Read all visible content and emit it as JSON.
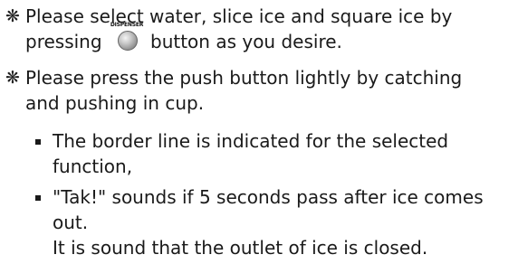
{
  "instructions": [
    {
      "marker": "❋",
      "lines": [
        "Please select water, slice ice and square ice by",
        "pressing",
        "button as you desire."
      ],
      "button": {
        "label": "DISPENSER",
        "icon": "dispenser-button-icon"
      }
    },
    {
      "marker": "❋",
      "lines": [
        "Please press the push button lightly by catching",
        "and pushing in cup."
      ]
    }
  ],
  "notes": [
    {
      "lines": [
        "The border line is indicated for the selected",
        "function,"
      ]
    },
    {
      "lines": [
        "\"Tak!\" sounds if 5 seconds pass after ice comes",
        "out.",
        "It is sound that the outlet of ice is closed."
      ]
    }
  ]
}
